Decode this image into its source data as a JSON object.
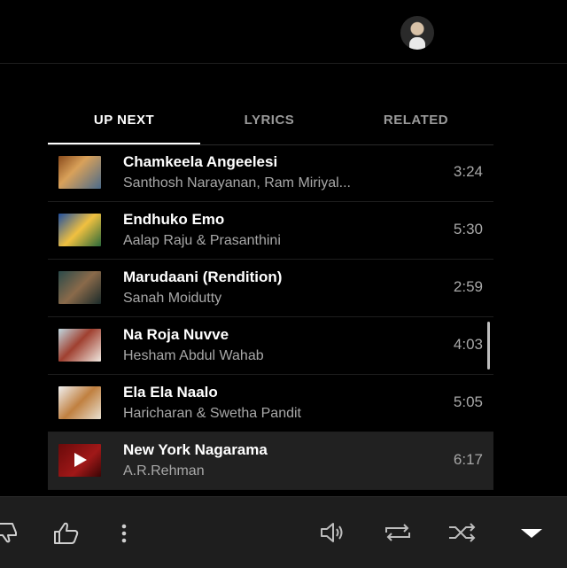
{
  "account": {
    "avatar_icon": "avatar-icon"
  },
  "tabs": [
    {
      "label": "UP NEXT",
      "active": true
    },
    {
      "label": "LYRICS",
      "active": false
    },
    {
      "label": "RELATED",
      "active": false
    }
  ],
  "queue": [
    {
      "title": "Chamkeela Angeelesi",
      "artist": "Santhosh Narayanan, Ram Miriyal...",
      "duration": "3:24"
    },
    {
      "title": "Endhuko Emo",
      "artist": "Aalap Raju & Prasanthini",
      "duration": "5:30"
    },
    {
      "title": "Marudaani (Rendition)",
      "artist": "Sanah Moidutty",
      "duration": "2:59"
    },
    {
      "title": "Na Roja Nuvve",
      "artist": "Hesham Abdul Wahab",
      "duration": "4:03"
    },
    {
      "title": "Ela Ela Naalo",
      "artist": "Haricharan & Swetha Pandit",
      "duration": "5:05"
    },
    {
      "title": "New York Nagarama",
      "artist": "A.R.Rehman",
      "duration": "6:17",
      "now_playing": true
    }
  ],
  "player_bar": {
    "icons": [
      "thumbs-down-icon",
      "thumbs-up-icon",
      "more-vert-icon",
      "volume-icon",
      "repeat-icon",
      "shuffle-icon",
      "collapse-arrow-icon"
    ]
  }
}
